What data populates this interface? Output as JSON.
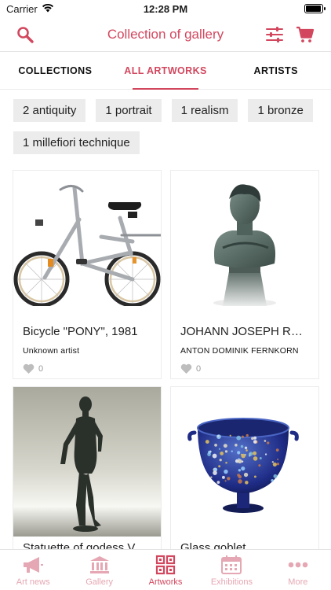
{
  "status_bar": {
    "carrier": "Carrier",
    "time": "12:28 PM",
    "battery_level": 0.95
  },
  "nav": {
    "title": "Collection of gallery",
    "icons": [
      "search-icon",
      "filter-sliders-icon",
      "cart-icon"
    ],
    "accent": "#d2475e"
  },
  "tabs": [
    {
      "label": "COLLECTIONS",
      "active": false
    },
    {
      "label": "ALL ARTWORKS",
      "active": true
    },
    {
      "label": "ARTISTS",
      "active": false
    }
  ],
  "filters": [
    "2 antiquity",
    "1 portrait",
    "1 realism",
    "1 bronze",
    "1 millefiori technique"
  ],
  "artworks": [
    {
      "title": "Bicycle \"PONY\", 1981",
      "artist": "Unknown artist",
      "likes": "0",
      "image": "bicycle"
    },
    {
      "title": "JOHANN JOSEPH RADETZKY",
      "artist": "ANTON DOMINIK FERNKORN",
      "likes": "0",
      "image": "bronze-bust"
    },
    {
      "title": "Statuette of godess Venus",
      "artist": "",
      "likes": "",
      "image": "bronze-statuette"
    },
    {
      "title": "Glass goblet",
      "artist": "",
      "likes": "",
      "image": "millefiori-goblet"
    }
  ],
  "tab_bar": [
    {
      "label": "Art news",
      "icon": "megaphone-icon",
      "active": false
    },
    {
      "label": "Gallery",
      "icon": "museum-icon",
      "active": false
    },
    {
      "label": "Artworks",
      "icon": "artworks-grid-icon",
      "active": true
    },
    {
      "label": "Exhibitions",
      "icon": "calendar-icon",
      "active": false
    },
    {
      "label": "More",
      "icon": "more-dots-icon",
      "active": false
    }
  ]
}
